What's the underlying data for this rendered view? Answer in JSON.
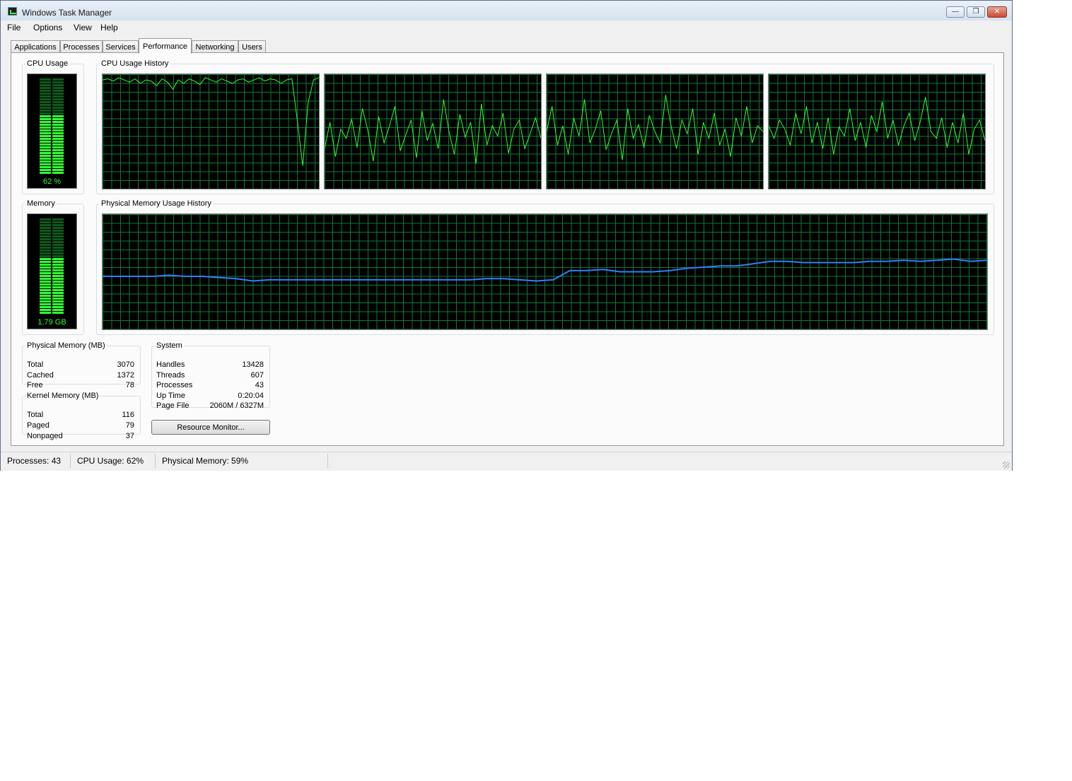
{
  "window": {
    "title": "Windows Task Manager"
  },
  "window_buttons": {
    "minimize": "—",
    "maximize": "❐",
    "close": "✕"
  },
  "menu": [
    "File",
    "Options",
    "View",
    "Help"
  ],
  "tabs": [
    {
      "label": "Applications",
      "active": false
    },
    {
      "label": "Processes",
      "active": false
    },
    {
      "label": "Services",
      "active": false
    },
    {
      "label": "Performance",
      "active": true
    },
    {
      "label": "Networking",
      "active": false
    },
    {
      "label": "Users",
      "active": false
    }
  ],
  "cpu_usage": {
    "label": "CPU Usage",
    "value_text": "62 %",
    "value_percent": 62
  },
  "cpu_history": {
    "label": "CPU Usage History",
    "cores": [
      [
        95,
        96,
        94,
        97,
        95,
        93,
        96,
        92,
        95,
        94,
        90,
        96,
        93,
        87,
        95,
        92,
        96,
        94,
        91,
        97,
        95,
        93,
        96,
        94,
        92,
        95,
        96,
        93,
        95,
        97,
        94,
        96,
        95,
        92,
        95,
        96,
        60,
        20,
        75,
        95,
        97
      ],
      [
        35,
        58,
        28,
        52,
        44,
        61,
        36,
        70,
        51,
        24,
        63,
        40,
        55,
        72,
        33,
        47,
        60,
        27,
        68,
        42,
        57,
        35,
        78,
        50,
        30,
        65,
        45,
        58,
        22,
        74,
        38,
        55,
        46,
        66,
        31,
        52,
        60,
        35,
        48,
        62,
        44
      ],
      [
        50,
        72,
        38,
        55,
        30,
        62,
        46,
        78,
        40,
        52,
        68,
        34,
        48,
        60,
        25,
        70,
        44,
        56,
        36,
        64,
        50,
        40,
        82,
        55,
        35,
        60,
        48,
        70,
        30,
        58,
        44,
        66,
        38,
        52,
        28,
        62,
        46,
        72,
        40,
        55,
        50
      ],
      [
        55,
        44,
        60,
        52,
        38,
        66,
        48,
        72,
        40,
        58,
        35,
        62,
        30,
        54,
        46,
        70,
        42,
        58,
        36,
        64,
        50,
        76,
        44,
        60,
        38,
        55,
        66,
        42,
        58,
        80,
        50,
        44,
        62,
        36,
        58,
        40,
        66,
        30,
        52,
        60,
        42
      ]
    ]
  },
  "memory": {
    "label": "Memory",
    "value_text": "1,79 GB",
    "value_percent": 59
  },
  "memory_history": {
    "label": "Physical Memory Usage History",
    "values": [
      46,
      46,
      46,
      46,
      47,
      46,
      46,
      45,
      44,
      42,
      43,
      43,
      43,
      43,
      43,
      43,
      43,
      43,
      43,
      43,
      43,
      43,
      43,
      44,
      44,
      43,
      42,
      43,
      51,
      51,
      52,
      50,
      50,
      50,
      51,
      53,
      54,
      55,
      55,
      57,
      59,
      59,
      58,
      58,
      58,
      58,
      59,
      59,
      60,
      59,
      60,
      61,
      59,
      60
    ]
  },
  "physical_memory": {
    "label": "Physical Memory (MB)",
    "rows": [
      {
        "label": "Total",
        "value": "3070"
      },
      {
        "label": "Cached",
        "value": "1372"
      },
      {
        "label": "Free",
        "value": "78"
      }
    ]
  },
  "kernel_memory": {
    "label": "Kernel Memory (MB)",
    "rows": [
      {
        "label": "Total",
        "value": "116"
      },
      {
        "label": "Paged",
        "value": "79"
      },
      {
        "label": "Nonpaged",
        "value": "37"
      }
    ]
  },
  "system": {
    "label": "System",
    "rows": [
      {
        "label": "Handles",
        "value": "13428"
      },
      {
        "label": "Threads",
        "value": "607"
      },
      {
        "label": "Processes",
        "value": "43"
      },
      {
        "label": "Up Time",
        "value": "0:20:04"
      },
      {
        "label": "Page File",
        "value": "2060M / 6327M"
      }
    ]
  },
  "resource_monitor_button": "Resource Monitor...",
  "status": {
    "processes": "Processes: 43",
    "cpu": "CPU Usage: 62%",
    "memory": "Physical Memory: 59%"
  },
  "colors": {
    "graph_grid": "#0d7a37",
    "cpu_line": "#33ff33",
    "memory_line": "#2f7fff",
    "meter_on": "#33ff33",
    "meter_off": "#0c5a1c"
  }
}
